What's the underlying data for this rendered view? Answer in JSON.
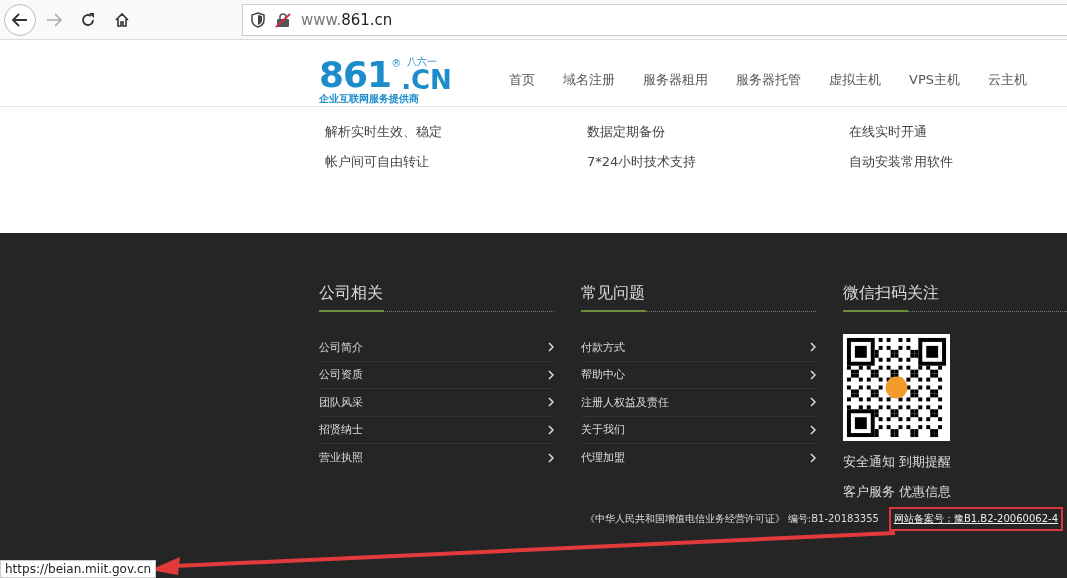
{
  "browser": {
    "url_prefix": "www.",
    "url_domain": "861.cn",
    "status_url": "https://beian.miit.gov.cn"
  },
  "logo": {
    "number": "861",
    "registered": "®",
    "chinese_number": "八六一",
    "suffix": ".CN",
    "tagline": "企业互联网服务提供商"
  },
  "nav": [
    "首页",
    "域名注册",
    "服务器租用",
    "服务器托管",
    "虚拟主机",
    "VPS主机",
    "云主机"
  ],
  "features": [
    [
      "解析实时生效、稳定",
      "帐户间可自由转让"
    ],
    [
      "数据定期备份",
      "7*24小时技术支持"
    ],
    [
      "在线实时开通",
      "自动安装常用软件"
    ]
  ],
  "footer": {
    "company": {
      "title": "公司相关",
      "links": [
        "公司简介",
        "公司资质",
        "团队风采",
        "招贤纳士",
        "营业执照"
      ]
    },
    "faq": {
      "title": "常见问题",
      "links": [
        "付款方式",
        "帮助中心",
        "注册人权益及责任",
        "关于我们",
        "代理加盟"
      ]
    },
    "wechat": {
      "title": "微信扫码关注",
      "lines": [
        "安全通知 到期提醒",
        "客户服务 优惠信息"
      ]
    }
  },
  "license": {
    "text": "《中华人民共和国增值电信业务经营许可证》 编号:B1-20183355",
    "record_link": "网站备案号：豫B1.B2-20060062-4"
  }
}
